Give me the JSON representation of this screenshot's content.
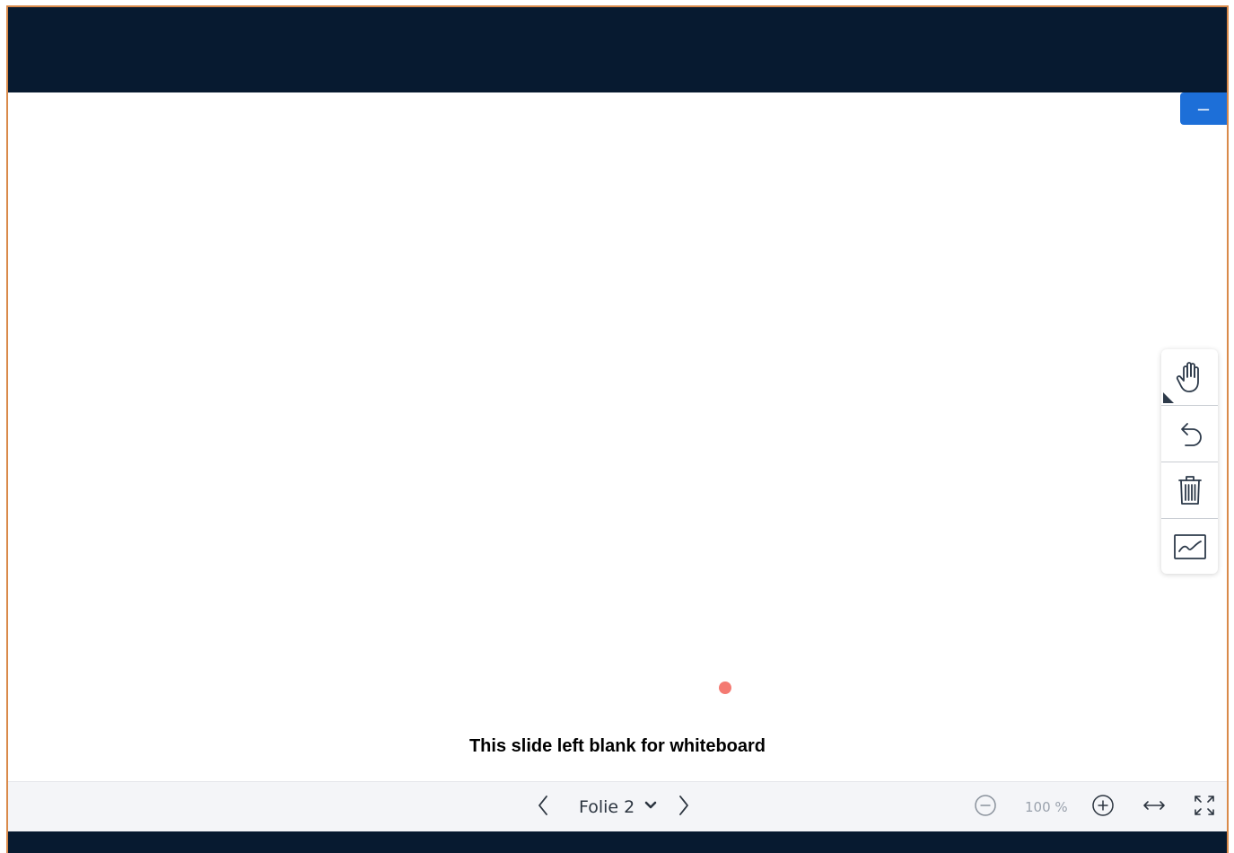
{
  "minimize": {
    "label": "–"
  },
  "slide": {
    "caption": "This slide left blank for whiteboard"
  },
  "toolbar": {
    "tools": [
      {
        "icon": "hand-icon"
      },
      {
        "icon": "undo-icon"
      },
      {
        "icon": "trash-icon"
      },
      {
        "icon": "line-chart-icon"
      }
    ]
  },
  "navigation": {
    "slide_label": "Folie 2",
    "prev_icon": "chevron-left-icon",
    "dropdown_icon": "chevron-down-icon",
    "next_icon": "chevron-right-icon"
  },
  "zoom": {
    "value": "100 %",
    "out_icon": "minus-circle-icon",
    "in_icon": "plus-circle-icon"
  },
  "view": {
    "fit_width_icon": "fit-width-icon",
    "fullscreen_icon": "fullscreen-icon"
  },
  "colors": {
    "header_bg": "#071a30",
    "accent_blue": "#1d6fd8",
    "laser_pointer": "#f47a72",
    "frame_border": "#d98a4a"
  }
}
